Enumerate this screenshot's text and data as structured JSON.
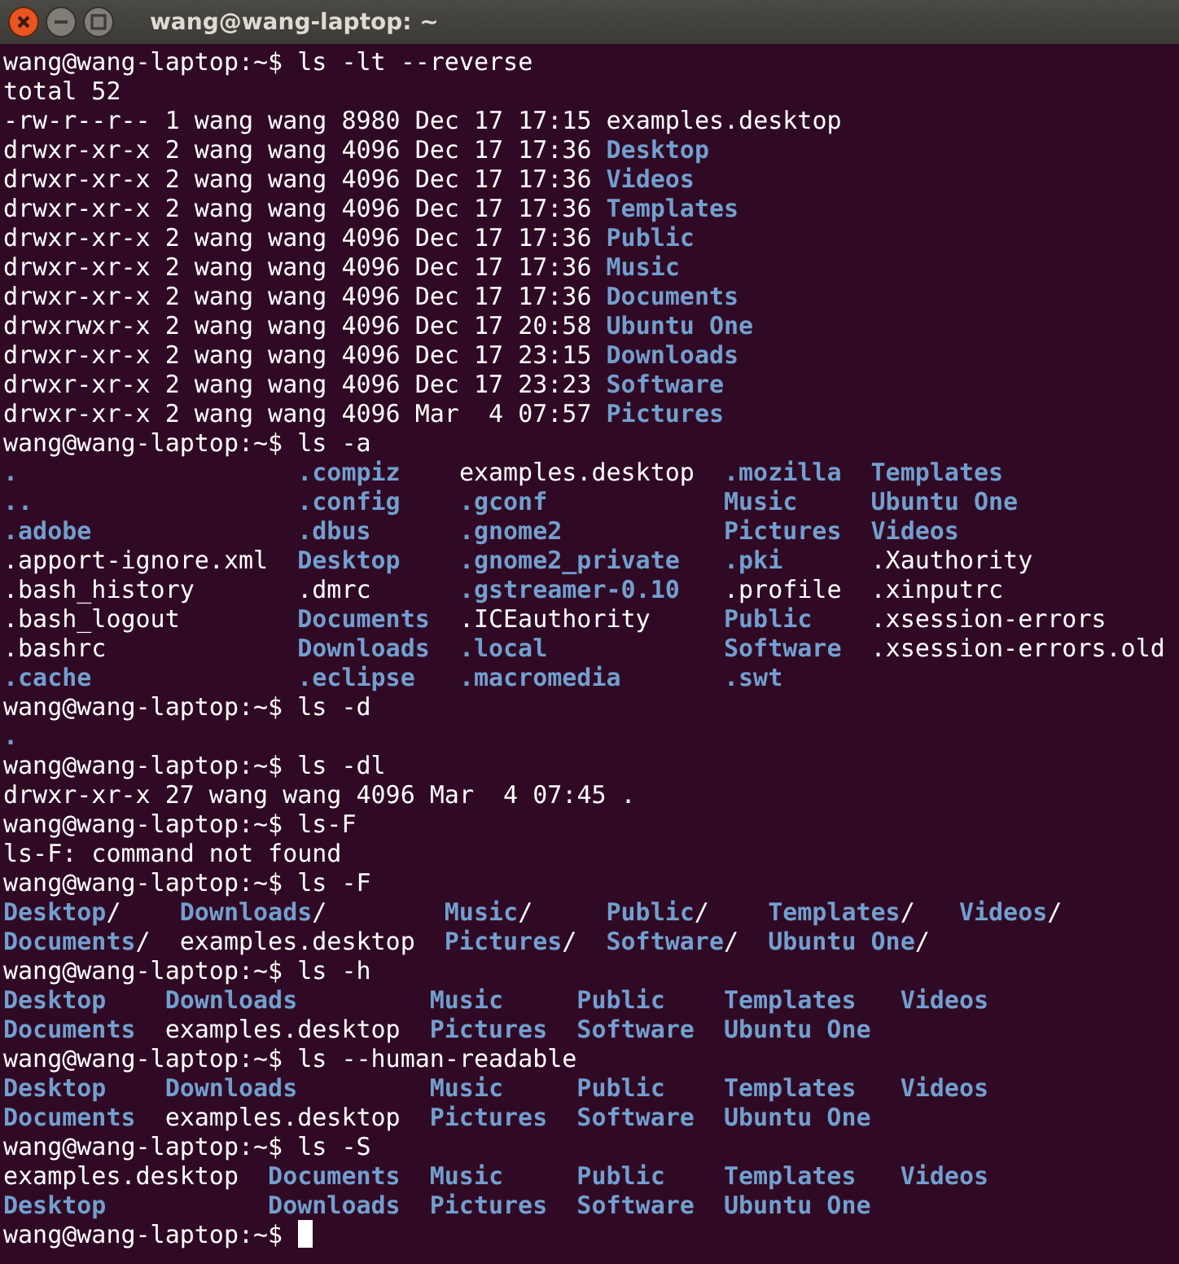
{
  "window": {
    "title": "wang@wang-laptop: ~"
  },
  "terminal": {
    "blocks": [
      {
        "kind": "prompt",
        "prompt": "wang@wang-laptop:~$",
        "command": "ls -lt --reverse",
        "cursor": false
      },
      {
        "kind": "output",
        "text": "total 52"
      },
      {
        "kind": "long",
        "rows": [
          {
            "info": "-rw-r--r-- 1 wang wang 8980 Dec 17 17:15",
            "name": "examples.desktop",
            "dir": false
          },
          {
            "info": "drwxr-xr-x 2 wang wang 4096 Dec 17 17:36",
            "name": "Desktop",
            "dir": true
          },
          {
            "info": "drwxr-xr-x 2 wang wang 4096 Dec 17 17:36",
            "name": "Videos",
            "dir": true
          },
          {
            "info": "drwxr-xr-x 2 wang wang 4096 Dec 17 17:36",
            "name": "Templates",
            "dir": true
          },
          {
            "info": "drwxr-xr-x 2 wang wang 4096 Dec 17 17:36",
            "name": "Public",
            "dir": true
          },
          {
            "info": "drwxr-xr-x 2 wang wang 4096 Dec 17 17:36",
            "name": "Music",
            "dir": true
          },
          {
            "info": "drwxr-xr-x 2 wang wang 4096 Dec 17 17:36",
            "name": "Documents",
            "dir": true
          },
          {
            "info": "drwxrwxr-x 2 wang wang 4096 Dec 17 20:58",
            "name": "Ubuntu One",
            "dir": true
          },
          {
            "info": "drwxr-xr-x 2 wang wang 4096 Dec 17 23:15",
            "name": "Downloads",
            "dir": true
          },
          {
            "info": "drwxr-xr-x 2 wang wang 4096 Dec 17 23:23",
            "name": "Software",
            "dir": true
          },
          {
            "info": "drwxr-xr-x 2 wang wang 4096 Mar  4 07:57",
            "name": "Pictures",
            "dir": true
          }
        ]
      },
      {
        "kind": "prompt",
        "prompt": "wang@wang-laptop:~$",
        "command": "ls -a",
        "cursor": false
      },
      {
        "kind": "columns",
        "rows": [
          [
            {
              "name": ".",
              "dir": true
            },
            {
              "name": ".compiz",
              "dir": true
            },
            {
              "name": "examples.desktop",
              "dir": false
            },
            {
              "name": ".mozilla",
              "dir": true
            },
            {
              "name": "Templates",
              "dir": true
            }
          ],
          [
            {
              "name": "..",
              "dir": true
            },
            {
              "name": ".config",
              "dir": true
            },
            {
              "name": ".gconf",
              "dir": true
            },
            {
              "name": "Music",
              "dir": true
            },
            {
              "name": "Ubuntu One",
              "dir": true
            }
          ],
          [
            {
              "name": ".adobe",
              "dir": true
            },
            {
              "name": ".dbus",
              "dir": true
            },
            {
              "name": ".gnome2",
              "dir": true
            },
            {
              "name": "Pictures",
              "dir": true
            },
            {
              "name": "Videos",
              "dir": true
            }
          ],
          [
            {
              "name": ".apport-ignore.xml",
              "dir": false
            },
            {
              "name": "Desktop",
              "dir": true
            },
            {
              "name": ".gnome2_private",
              "dir": true
            },
            {
              "name": ".pki",
              "dir": true
            },
            {
              "name": ".Xauthority",
              "dir": false
            }
          ],
          [
            {
              "name": ".bash_history",
              "dir": false
            },
            {
              "name": ".dmrc",
              "dir": false
            },
            {
              "name": ".gstreamer-0.10",
              "dir": true
            },
            {
              "name": ".profile",
              "dir": false
            },
            {
              "name": ".xinputrc",
              "dir": false
            }
          ],
          [
            {
              "name": ".bash_logout",
              "dir": false
            },
            {
              "name": "Documents",
              "dir": true
            },
            {
              "name": ".ICEauthority",
              "dir": false
            },
            {
              "name": "Public",
              "dir": true
            },
            {
              "name": ".xsession-errors",
              "dir": false
            }
          ],
          [
            {
              "name": ".bashrc",
              "dir": false
            },
            {
              "name": "Downloads",
              "dir": true
            },
            {
              "name": ".local",
              "dir": true
            },
            {
              "name": "Software",
              "dir": true
            },
            {
              "name": ".xsession-errors.old",
              "dir": false
            }
          ],
          [
            {
              "name": ".cache",
              "dir": true
            },
            {
              "name": ".eclipse",
              "dir": true
            },
            {
              "name": ".macromedia",
              "dir": true
            },
            {
              "name": ".swt",
              "dir": true
            }
          ]
        ]
      },
      {
        "kind": "prompt",
        "prompt": "wang@wang-laptop:~$",
        "command": "ls -d",
        "cursor": false
      },
      {
        "kind": "columns",
        "rows": [
          [
            {
              "name": ".",
              "dir": true
            }
          ]
        ]
      },
      {
        "kind": "prompt",
        "prompt": "wang@wang-laptop:~$",
        "command": "ls -dl",
        "cursor": false
      },
      {
        "kind": "long",
        "rows": [
          {
            "info": "drwxr-xr-x 27 wang wang 4096 Mar  4 07:45",
            "name": ".",
            "dir": false
          }
        ]
      },
      {
        "kind": "prompt",
        "prompt": "wang@wang-laptop:~$",
        "command": "ls-F",
        "cursor": false
      },
      {
        "kind": "output",
        "text": "ls-F: command not found"
      },
      {
        "kind": "prompt",
        "prompt": "wang@wang-laptop:~$",
        "command": "ls -F",
        "cursor": false
      },
      {
        "kind": "columns",
        "rows": [
          [
            {
              "name": "Desktop",
              "dir": true,
              "suffix": "/"
            },
            {
              "name": "Downloads",
              "dir": true,
              "suffix": "/"
            },
            {
              "name": "Music",
              "dir": true,
              "suffix": "/"
            },
            {
              "name": "Public",
              "dir": true,
              "suffix": "/"
            },
            {
              "name": "Templates",
              "dir": true,
              "suffix": "/"
            },
            {
              "name": "Videos",
              "dir": true,
              "suffix": "/"
            }
          ],
          [
            {
              "name": "Documents",
              "dir": true,
              "suffix": "/"
            },
            {
              "name": "examples.desktop",
              "dir": false
            },
            {
              "name": "Pictures",
              "dir": true,
              "suffix": "/"
            },
            {
              "name": "Software",
              "dir": true,
              "suffix": "/"
            },
            {
              "name": "Ubuntu One",
              "dir": true,
              "suffix": "/"
            }
          ]
        ]
      },
      {
        "kind": "prompt",
        "prompt": "wang@wang-laptop:~$",
        "command": "ls -h",
        "cursor": false
      },
      {
        "kind": "columns",
        "rows": [
          [
            {
              "name": "Desktop",
              "dir": true
            },
            {
              "name": "Downloads",
              "dir": true
            },
            {
              "name": "Music",
              "dir": true
            },
            {
              "name": "Public",
              "dir": true
            },
            {
              "name": "Templates",
              "dir": true
            },
            {
              "name": "Videos",
              "dir": true
            }
          ],
          [
            {
              "name": "Documents",
              "dir": true
            },
            {
              "name": "examples.desktop",
              "dir": false
            },
            {
              "name": "Pictures",
              "dir": true
            },
            {
              "name": "Software",
              "dir": true
            },
            {
              "name": "Ubuntu One",
              "dir": true
            }
          ]
        ]
      },
      {
        "kind": "prompt",
        "prompt": "wang@wang-laptop:~$",
        "command": "ls --human-readable",
        "cursor": false
      },
      {
        "kind": "columns",
        "rows": [
          [
            {
              "name": "Desktop",
              "dir": true
            },
            {
              "name": "Downloads",
              "dir": true
            },
            {
              "name": "Music",
              "dir": true
            },
            {
              "name": "Public",
              "dir": true
            },
            {
              "name": "Templates",
              "dir": true
            },
            {
              "name": "Videos",
              "dir": true
            }
          ],
          [
            {
              "name": "Documents",
              "dir": true
            },
            {
              "name": "examples.desktop",
              "dir": false
            },
            {
              "name": "Pictures",
              "dir": true
            },
            {
              "name": "Software",
              "dir": true
            },
            {
              "name": "Ubuntu One",
              "dir": true
            }
          ]
        ]
      },
      {
        "kind": "prompt",
        "prompt": "wang@wang-laptop:~$",
        "command": "ls -S",
        "cursor": false
      },
      {
        "kind": "columns",
        "rows": [
          [
            {
              "name": "examples.desktop",
              "dir": false
            },
            {
              "name": "Documents",
              "dir": true
            },
            {
              "name": "Music",
              "dir": true
            },
            {
              "name": "Public",
              "dir": true
            },
            {
              "name": "Templates",
              "dir": true
            },
            {
              "name": "Videos",
              "dir": true
            }
          ],
          [
            {
              "name": "Desktop",
              "dir": true
            },
            {
              "name": "Downloads",
              "dir": true
            },
            {
              "name": "Pictures",
              "dir": true
            },
            {
              "name": "Software",
              "dir": true
            },
            {
              "name": "Ubuntu One",
              "dir": true
            }
          ]
        ]
      },
      {
        "kind": "prompt",
        "prompt": "wang@wang-laptop:~$",
        "cursor": true
      }
    ]
  }
}
